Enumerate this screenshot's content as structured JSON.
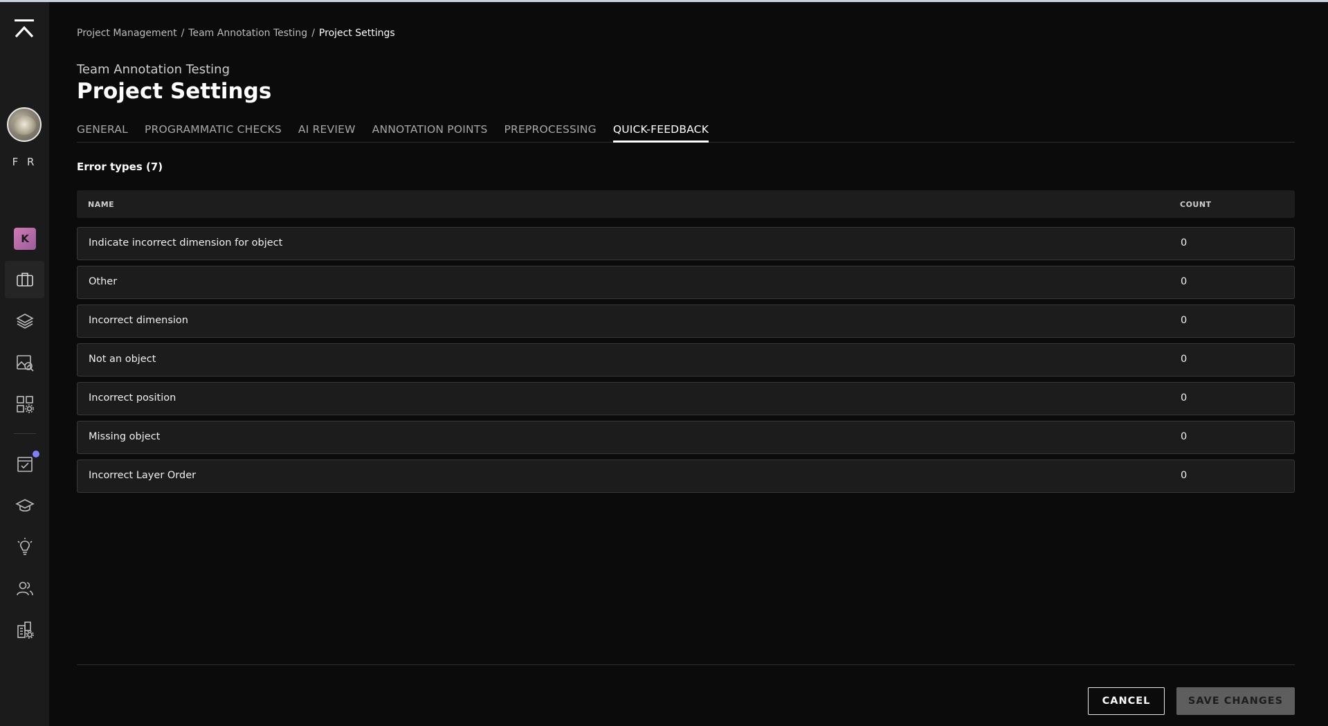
{
  "sidebar": {
    "initials": "F R",
    "workspace_badge": "K",
    "nav_icons": [
      "briefcase-icon",
      "layers-icon",
      "image-search-icon",
      "apps-settings-icon",
      "task-check-icon",
      "graduation-cap-icon",
      "lightbulb-icon",
      "users-icon",
      "building-settings-icon"
    ]
  },
  "breadcrumb": {
    "items": [
      "Project Management",
      "Team Annotation Testing"
    ],
    "current": "Project Settings",
    "separator": "/"
  },
  "header": {
    "subtitle": "Team Annotation Testing",
    "title": "Project Settings"
  },
  "tabs": [
    {
      "label": "GENERAL"
    },
    {
      "label": "PROGRAMMATIC CHECKS"
    },
    {
      "label": "AI REVIEW"
    },
    {
      "label": "ANNOTATION POINTS"
    },
    {
      "label": "PREPROCESSING"
    },
    {
      "label": "QUICK-FEEDBACK"
    }
  ],
  "active_tab": "QUICK-FEEDBACK",
  "section": {
    "title": "Error types (7)"
  },
  "table": {
    "headers": {
      "name": "NAME",
      "count": "COUNT"
    },
    "rows": [
      {
        "name": "Indicate incorrect dimension for object",
        "count": "0"
      },
      {
        "name": "Other",
        "count": "0"
      },
      {
        "name": "Incorrect dimension",
        "count": "0"
      },
      {
        "name": "Not an object",
        "count": "0"
      },
      {
        "name": "Incorrect position",
        "count": "0"
      },
      {
        "name": "Missing object",
        "count": "0"
      },
      {
        "name": "Incorrect Layer Order",
        "count": "0"
      }
    ]
  },
  "footer": {
    "cancel_label": "CANCEL",
    "save_label": "SAVE CHANGES"
  },
  "colors": {
    "background": "#0b0b0b",
    "sidebar": "#1b1b1b",
    "row_background": "#1c1c1c",
    "notification_dot": "#7f7fff",
    "workspace_badge": "#c36fa9"
  }
}
